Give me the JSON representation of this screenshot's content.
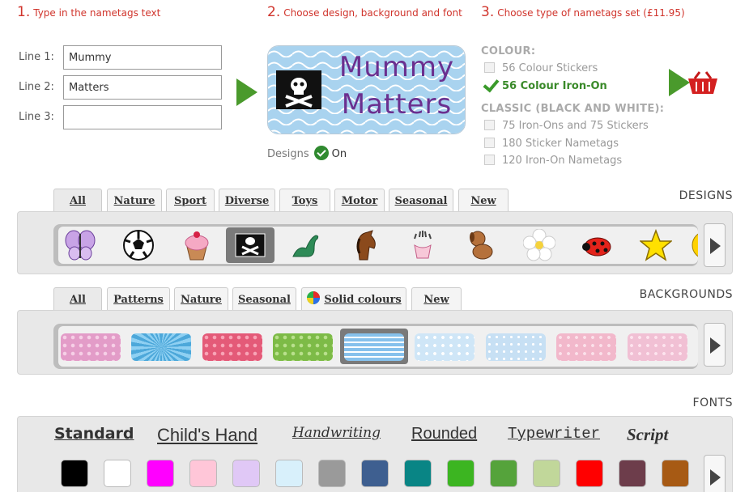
{
  "steps": [
    {
      "num": "1.",
      "text": "Type in the nametags text"
    },
    {
      "num": "2.",
      "text": "Choose design, background and font"
    },
    {
      "num": "3.",
      "text": "Choose type of nametags set (£11.95)"
    }
  ],
  "lines": [
    {
      "label": "Line 1:",
      "value": "Mummy"
    },
    {
      "label": "Line 2:",
      "value": "Matters"
    },
    {
      "label": "Line 3:",
      "value": ""
    }
  ],
  "preview": {
    "line1": "Mummy",
    "line2": "Matters"
  },
  "designs_toggle": {
    "label": "Designs",
    "state": "On"
  },
  "sets": {
    "colour_head": "COLOUR:",
    "colour_options": [
      {
        "label": "56 Colour Stickers",
        "selected": false
      },
      {
        "label": "56 Colour Iron-On",
        "selected": true
      }
    ],
    "classic_head": "CLASSIC (BLACK AND WHITE):",
    "classic_options": [
      {
        "label": "75 Iron-Ons and 75 Stickers",
        "selected": false
      },
      {
        "label": "180 Sticker Nametags",
        "selected": false
      },
      {
        "label": "120 Iron-On Nametags",
        "selected": false
      }
    ]
  },
  "designs": {
    "title": "DESIGNS",
    "tabs": [
      "All",
      "Nature",
      "Sport",
      "Diverse",
      "Toys",
      "Motor",
      "Seasonal",
      "New"
    ],
    "items": [
      "butterfly-icon",
      "football-icon",
      "cupcake-icon",
      "pirate-flag-icon",
      "dinosaur-icon",
      "horse-icon",
      "crown-icon",
      "dog-icon",
      "flower-icon",
      "ladybird-icon",
      "star-icon",
      "smiley-icon"
    ],
    "selected": 3
  },
  "backgrounds": {
    "title": "BACKGROUNDS",
    "tabs": [
      "All",
      "Patterns",
      "Nature",
      "Seasonal",
      "Solid colours",
      "New"
    ],
    "swatches": [
      "#e9a9cf",
      "#5cb1dd",
      "#ea6a83",
      "#8ac657",
      "#8cc3ec",
      "#d6e9f7",
      "#cfe3f4",
      "#f4c6d6",
      "#f4cfe0"
    ],
    "selected": 4
  },
  "fonts": {
    "title": "FONTS",
    "names": [
      "Standard",
      "Child's Hand",
      "Handwriting",
      "Rounded",
      "Typewriter",
      "Script"
    ],
    "colors": [
      "#000000",
      "#ffffff",
      "#ff00ff",
      "#ffc6d8",
      "#e0c8f6",
      "#d8f0fb",
      "#9a9a9a",
      "#3e5f90",
      "#098585",
      "#3cb521",
      "#55a33b",
      "#c1d79a",
      "#ff0000",
      "#6d3d4b",
      "#a75a14"
    ]
  }
}
